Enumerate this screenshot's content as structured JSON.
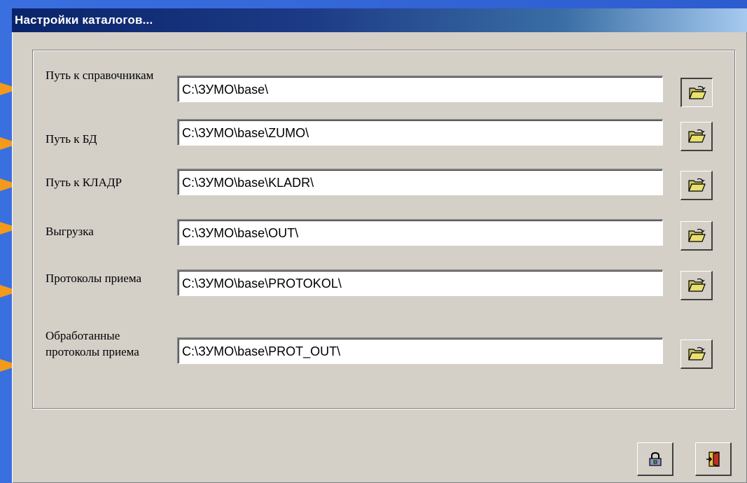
{
  "window": {
    "title": "Настройки каталогов..."
  },
  "rows": [
    {
      "label": "Путь к справочникам",
      "value": "C:\\ЗУМО\\base\\"
    },
    {
      "label": "Путь к БД",
      "value": "C:\\ЗУМО\\base\\ZUMO\\"
    },
    {
      "label": "Путь к КЛАДР",
      "value": "C:\\ЗУМО\\base\\KLADR\\"
    },
    {
      "label": "Выгрузка",
      "value": "C:\\ЗУМО\\base\\OUT\\"
    },
    {
      "label": "Протоколы приема",
      "value": "C:\\ЗУМО\\base\\PROTOKOL\\"
    },
    {
      "label": "Обработанные протоколы приема",
      "value": "C:\\ЗУМО\\base\\PROT_OUT\\"
    }
  ],
  "icons": {
    "browse": "open-folder-icon",
    "save": "lock-icon",
    "exit": "door-exit-icon"
  },
  "colors": {
    "dialog_bg": "#d4d0c8",
    "title_start": "#0a246a",
    "title_end": "#a6caf0",
    "slide_bg": "#2f5fd3",
    "arrow": "#f39a1a",
    "folder": "#e8e070"
  }
}
